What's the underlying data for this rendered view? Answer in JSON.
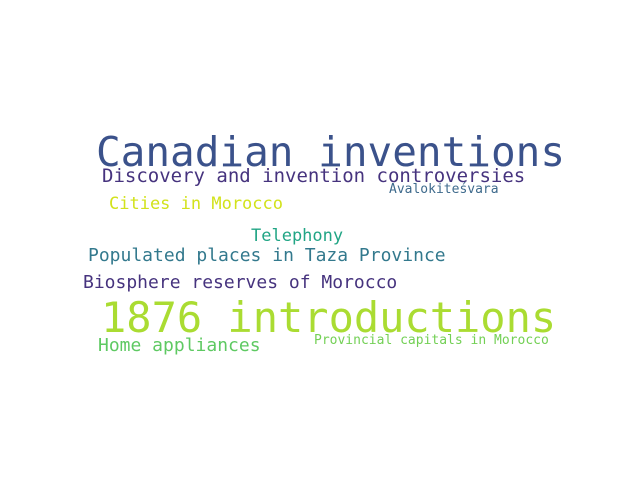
{
  "words": [
    {
      "text": "Canadian inventions",
      "color": "#3b528b"
    },
    {
      "text": "Discovery and invention controversies",
      "color": "#46337e"
    },
    {
      "text": "Avalokiteśvara",
      "color": "#3e6a8c"
    },
    {
      "text": "Cities in Morocco",
      "color": "#d2e21b"
    },
    {
      "text": "Telephony",
      "color": "#21a585"
    },
    {
      "text": "Populated places in Taza Province",
      "color": "#33798d"
    },
    {
      "text": "Biosphere reserves of Morocco",
      "color": "#46337e"
    },
    {
      "text": "1876 introductions",
      "color": "#aadc32"
    },
    {
      "text": "Home appliances",
      "color": "#5ec962"
    },
    {
      "text": "Provincial capitals in Morocco",
      "color": "#73d055"
    }
  ]
}
